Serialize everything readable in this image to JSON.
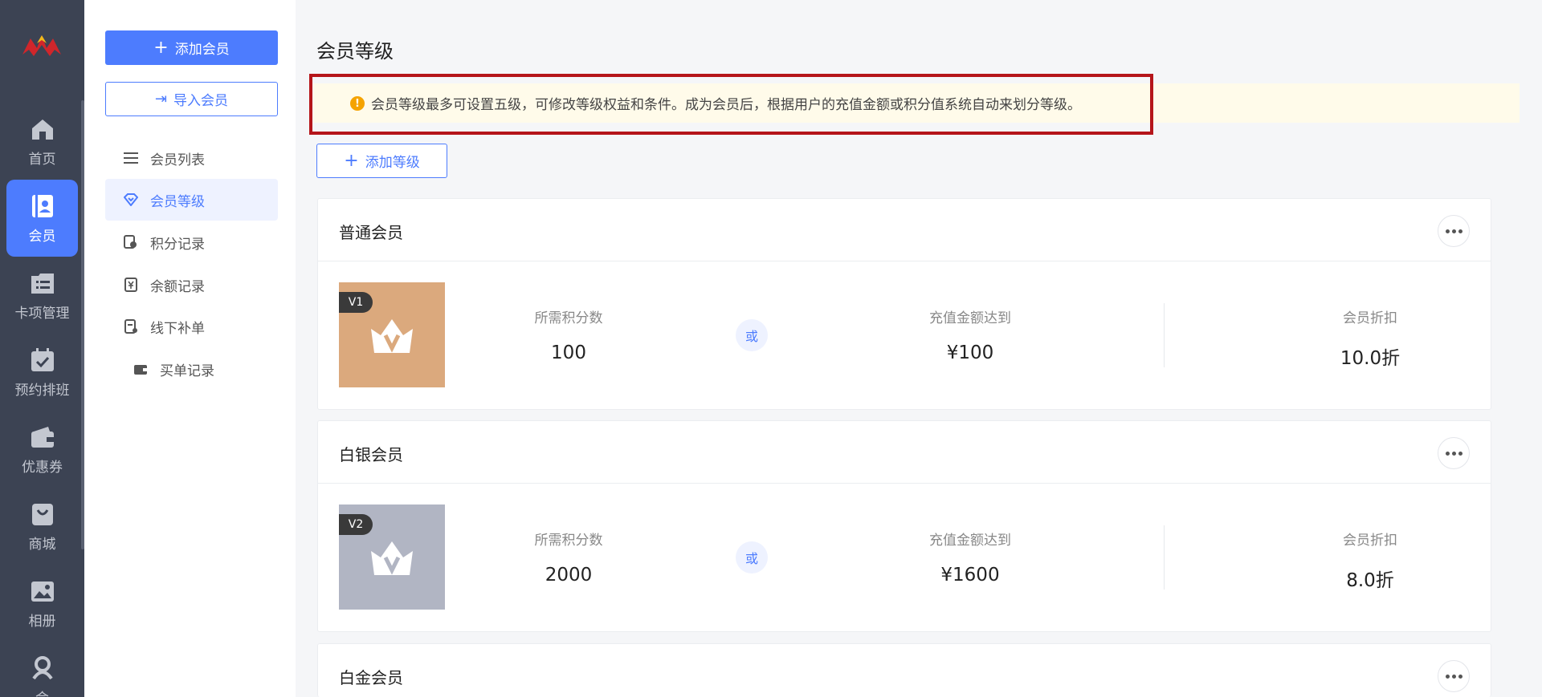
{
  "rail": {
    "items": [
      {
        "label": "首页",
        "icon": "home-icon"
      },
      {
        "label": "会员",
        "icon": "member-card-icon",
        "active": true
      },
      {
        "label": "卡项管理",
        "icon": "card-list-icon"
      },
      {
        "label": "预约排班",
        "icon": "calendar-icon"
      },
      {
        "label": "优惠券",
        "icon": "wallet-icon"
      },
      {
        "label": "商城",
        "icon": "shopping-bag-icon"
      },
      {
        "label": "相册",
        "icon": "photo-icon"
      },
      {
        "label": "会",
        "icon": "people-icon"
      }
    ]
  },
  "subnav": {
    "add_member": "添加会员",
    "import_member": "导入会员",
    "items": [
      {
        "label": "会员列表",
        "icon": "list-icon"
      },
      {
        "label": "会员等级",
        "icon": "diamond-icon",
        "active": true
      },
      {
        "label": "积分记录",
        "icon": "points-icon"
      },
      {
        "label": "余额记录",
        "icon": "yen-icon"
      },
      {
        "label": "线下补单",
        "icon": "receipt-icon"
      },
      {
        "label": "买单记录",
        "icon": "wallet-small-icon"
      }
    ]
  },
  "main": {
    "title": "会员等级",
    "notice": "会员等级最多可设置五级，可修改等级权益和条件。成为会员后，根据用户的充值金额或积分值系统自动来划分等级。",
    "add_level": "添加等级",
    "labels": {
      "points_required": "所需积分数",
      "or": "或",
      "recharge_reached": "充值金额达到",
      "discount": "会员折扣"
    },
    "levels": [
      {
        "name": "普通会员",
        "tag": "V1",
        "color": "#dba97d",
        "points": "100",
        "recharge": "¥100",
        "discount": "10.0折"
      },
      {
        "name": "白银会员",
        "tag": "V2",
        "color": "#b1b5c3",
        "points": "2000",
        "recharge": "¥1600",
        "discount": "8.0折"
      },
      {
        "name": "白金会员"
      }
    ]
  }
}
